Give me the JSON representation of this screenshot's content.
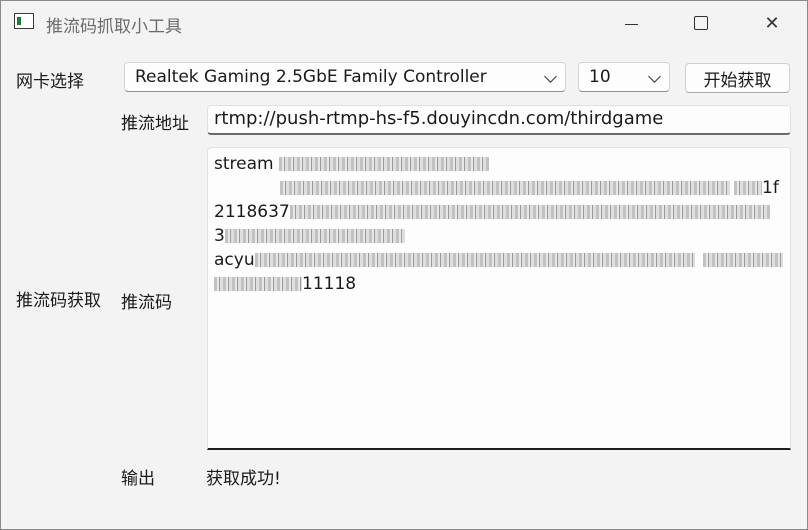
{
  "window": {
    "title": "推流码抓取小工具"
  },
  "labels": {
    "nic": "网卡选择",
    "url": "推流地址",
    "group": "推流码获取",
    "code": "推流码",
    "output": "输出"
  },
  "nic_select": {
    "value": "Realtek Gaming 2.5GbE Family Controller"
  },
  "count_select": {
    "value": "10"
  },
  "start_button": {
    "label": "开始获取"
  },
  "push_url": {
    "value": "rtmp://push-rtmp-hs-f5.douyincdn.com/thirdgame"
  },
  "push_code": {
    "line1_prefix": "stream",
    "line2_suffix": "1f",
    "line3_prefix": "2118637",
    "line4_prefix": "3",
    "line5_prefix": "acyu",
    "line6_suffix": "11118"
  },
  "output": {
    "value": "获取成功!"
  }
}
